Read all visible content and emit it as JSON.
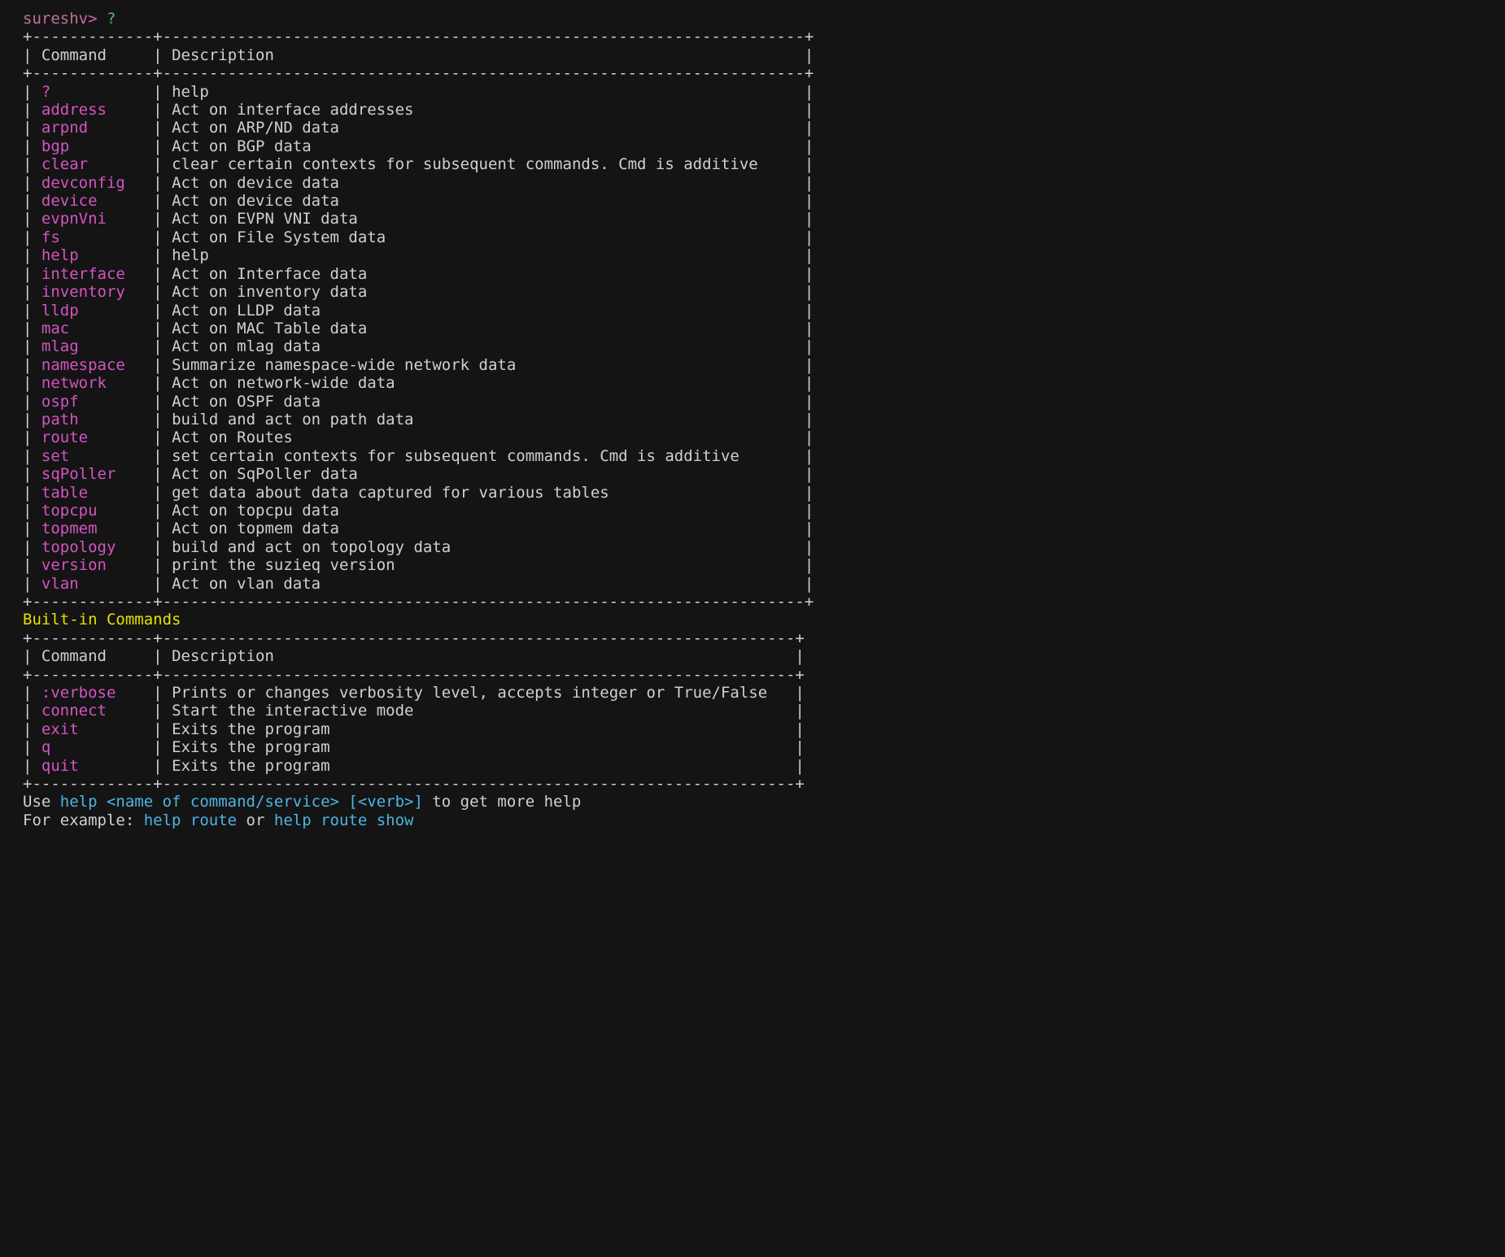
{
  "prompt": {
    "user": "sureshv",
    "gt": ">",
    "cmd": "?"
  },
  "table1": {
    "headers": {
      "col1": "Command",
      "col2": "Description"
    },
    "rows": [
      {
        "cmd": "?",
        "desc": "help"
      },
      {
        "cmd": "address",
        "desc": "Act on interface addresses"
      },
      {
        "cmd": "arpnd",
        "desc": "Act on ARP/ND data"
      },
      {
        "cmd": "bgp",
        "desc": "Act on BGP data"
      },
      {
        "cmd": "clear",
        "desc": "clear certain contexts for subsequent commands. Cmd is additive"
      },
      {
        "cmd": "devconfig",
        "desc": "Act on device data"
      },
      {
        "cmd": "device",
        "desc": "Act on device data"
      },
      {
        "cmd": "evpnVni",
        "desc": "Act on EVPN VNI data"
      },
      {
        "cmd": "fs",
        "desc": "Act on File System data"
      },
      {
        "cmd": "help",
        "desc": "help"
      },
      {
        "cmd": "interface",
        "desc": "Act on Interface data"
      },
      {
        "cmd": "inventory",
        "desc": "Act on inventory data"
      },
      {
        "cmd": "lldp",
        "desc": "Act on LLDP data"
      },
      {
        "cmd": "mac",
        "desc": "Act on MAC Table data"
      },
      {
        "cmd": "mlag",
        "desc": "Act on mlag data"
      },
      {
        "cmd": "namespace",
        "desc": "Summarize namespace-wide network data"
      },
      {
        "cmd": "network",
        "desc": "Act on network-wide data"
      },
      {
        "cmd": "ospf",
        "desc": "Act on OSPF data"
      },
      {
        "cmd": "path",
        "desc": "build and act on path data"
      },
      {
        "cmd": "route",
        "desc": "Act on Routes"
      },
      {
        "cmd": "set",
        "desc": "set certain contexts for subsequent commands. Cmd is additive"
      },
      {
        "cmd": "sqPoller",
        "desc": "Act on SqPoller data"
      },
      {
        "cmd": "table",
        "desc": "get data about data captured for various tables"
      },
      {
        "cmd": "topcpu",
        "desc": "Act on topcpu data"
      },
      {
        "cmd": "topmem",
        "desc": "Act on topmem data"
      },
      {
        "cmd": "topology",
        "desc": "build and act on topology data"
      },
      {
        "cmd": "version",
        "desc": "print the suzieq version"
      },
      {
        "cmd": "vlan",
        "desc": "Act on vlan data"
      }
    ]
  },
  "builtin_header": "Built-in Commands",
  "table2": {
    "headers": {
      "col1": "Command",
      "col2": "Description"
    },
    "rows": [
      {
        "cmd": ":verbose",
        "desc": "Prints or changes verbosity level, accepts integer or True/False"
      },
      {
        "cmd": "connect",
        "desc": "Start the interactive mode"
      },
      {
        "cmd": "exit",
        "desc": "Exits the program"
      },
      {
        "cmd": "q",
        "desc": "Exits the program"
      },
      {
        "cmd": "quit",
        "desc": "Exits the program"
      }
    ]
  },
  "footer": {
    "line1_pre": "Use ",
    "line1_help": "help",
    "line1_arg": " <name of command/service> [<verb>]",
    "line1_post": " to get more help",
    "line2_pre": "For example: ",
    "line2_a": "help route",
    "line2_mid": " or ",
    "line2_b": "help route show"
  },
  "layout": {
    "col1_width": 11,
    "col2_width": 67,
    "col2b_width": 66
  }
}
